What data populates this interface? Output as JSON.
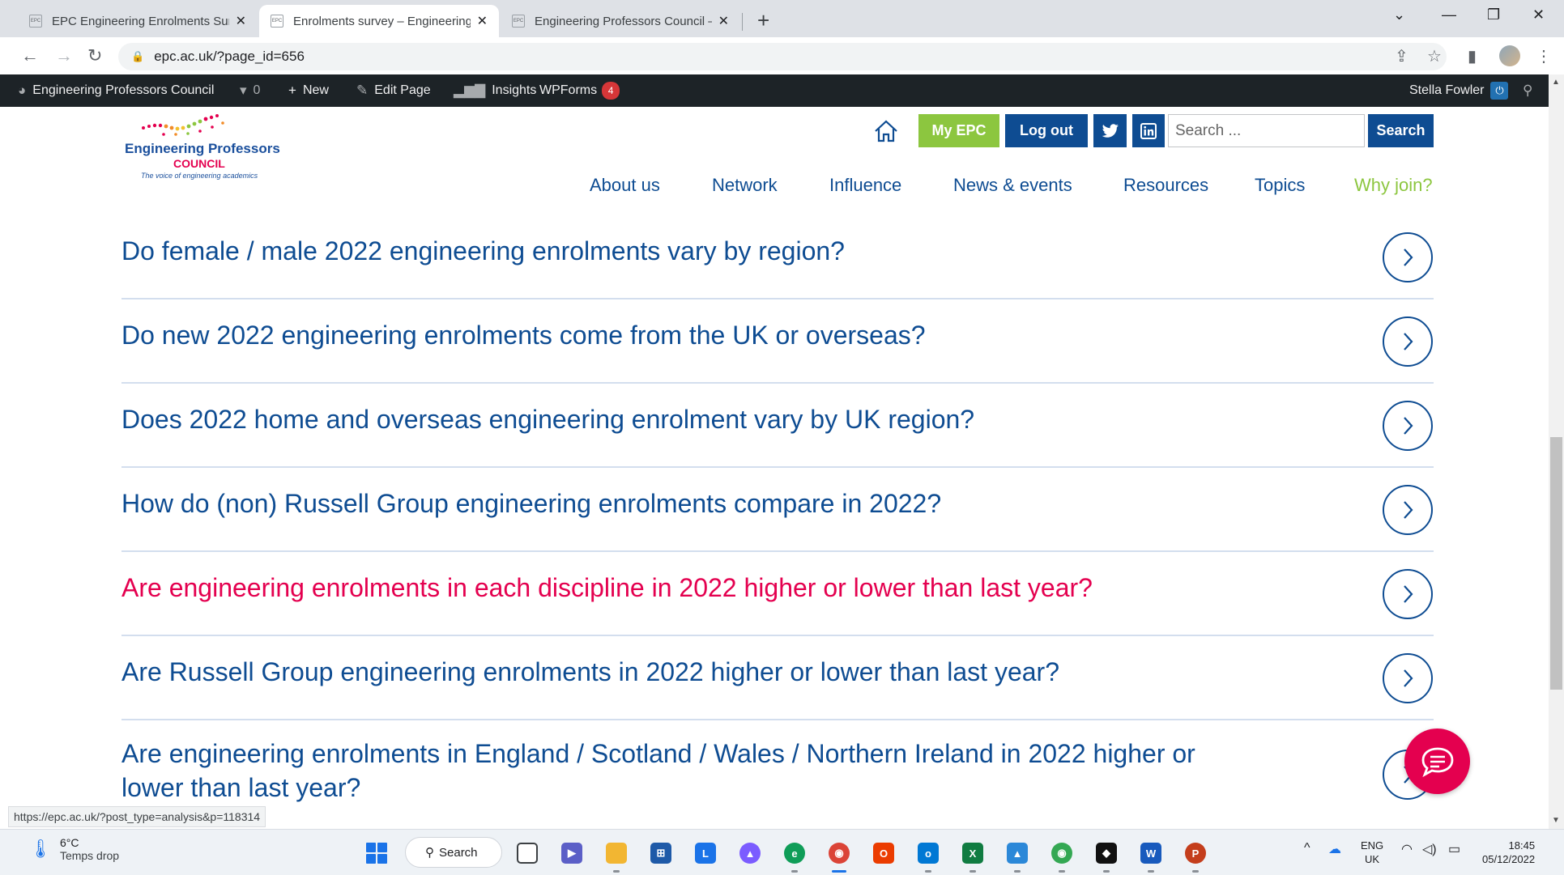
{
  "browser": {
    "tabs": [
      {
        "title": "EPC Engineering Enrolments Surv",
        "favicon": "EPC",
        "active": false
      },
      {
        "title": "Enrolments survey – Engineering",
        "favicon": "EPC",
        "active": true
      },
      {
        "title": "Engineering Professors Council –",
        "favicon": "EPC",
        "active": false
      }
    ],
    "url": "epc.ac.uk/?page_id=656",
    "status_link": "https://epc.ac.uk/?post_type=analysis&p=118314"
  },
  "adminbar": {
    "site_name": "Engineering Professors Council",
    "comments_count": "0",
    "new_label": "New",
    "edit_label": "Edit Page",
    "insights_label": "Insights",
    "wpforms_label": "WPForms",
    "wpforms_badge": "4",
    "user_name": "Stella Fowler"
  },
  "header": {
    "logo_line1": "Engineering Professors",
    "logo_line2": "COUNCIL",
    "logo_line3": "The voice of engineering academics",
    "my_epc_label": "My EPC",
    "logout_label": "Log out",
    "search_placeholder": "Search ...",
    "search_button": "Search",
    "nav": [
      "About us",
      "Network",
      "Influence",
      "News & events",
      "Resources",
      "Topics",
      "Why join?"
    ]
  },
  "questions": [
    {
      "text": "Do female / male 2022 engineering enrolments vary by region?",
      "highlight": false
    },
    {
      "text": "Do new 2022 engineering enrolments come from the UK or overseas?",
      "highlight": false
    },
    {
      "text": "Does 2022 home and overseas engineering enrolment vary by UK region?",
      "highlight": false
    },
    {
      "text": "How do (non) Russell Group engineering enrolments compare in 2022?",
      "highlight": false
    },
    {
      "text": "Are engineering enrolments in each discipline in 2022 higher or lower than last year?",
      "highlight": true
    },
    {
      "text": "Are Russell Group engineering enrolments in 2022 higher or lower than last year?",
      "highlight": false
    },
    {
      "text": "Are engineering enrolments in England / Scotland / Wales / Northern Ireland in 2022 higher or lower than last year?",
      "highlight": false
    }
  ],
  "colors": {
    "brand_blue": "#0e4c92",
    "brand_green": "#8cc63f",
    "brand_pink": "#e4004f",
    "adminbar": "#1d2327"
  },
  "taskbar": {
    "weather_temp": "6°C",
    "weather_desc": "Temps drop",
    "search_label": "Search",
    "lang_line1": "ENG",
    "lang_line2": "UK",
    "time": "18:45",
    "date": "05/12/2022"
  }
}
